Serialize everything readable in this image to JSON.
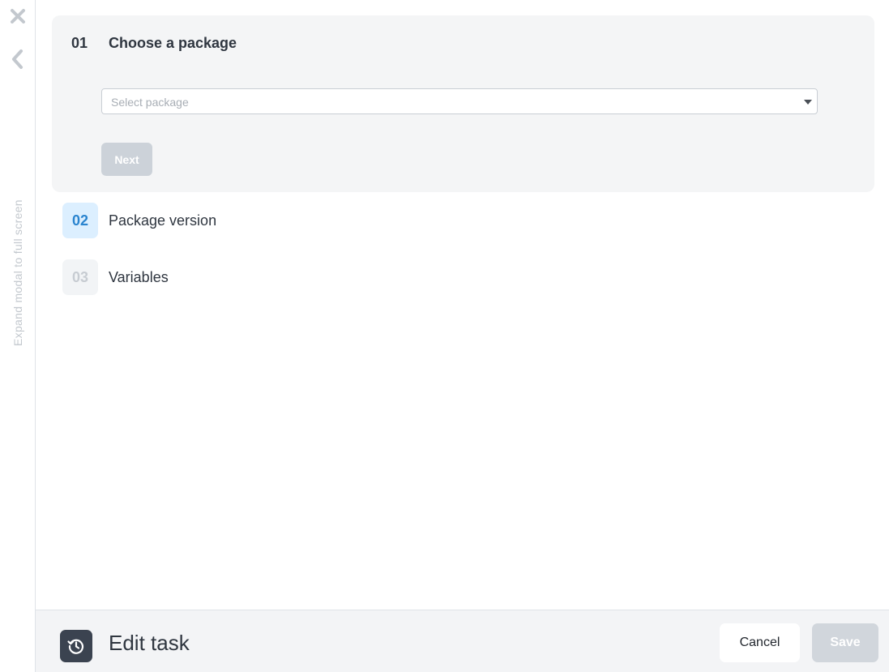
{
  "rail": {
    "close_icon": "close-icon",
    "back_icon": "chevron-left-icon",
    "expand_label": "Expand modal to full screen"
  },
  "steps": [
    {
      "number": "01",
      "title": "Choose a package",
      "state": "active",
      "select": {
        "placeholder": "Select package",
        "value": ""
      },
      "next_label": "Next",
      "next_disabled": true
    },
    {
      "number": "02",
      "title": "Package version",
      "state": "upcoming"
    },
    {
      "number": "03",
      "title": "Variables",
      "state": "disabled"
    }
  ],
  "footer": {
    "icon": "history-icon",
    "title": "Edit task",
    "cancel_label": "Cancel",
    "save_label": "Save",
    "save_disabled": true
  },
  "colors": {
    "step_active_bg": "#f4f5f6",
    "step2_badge_bg": "#dcefff",
    "step2_badge_text": "#2a84cf",
    "disabled_button": "#ccd2d9",
    "footer_icon_bg": "#3b4350"
  }
}
